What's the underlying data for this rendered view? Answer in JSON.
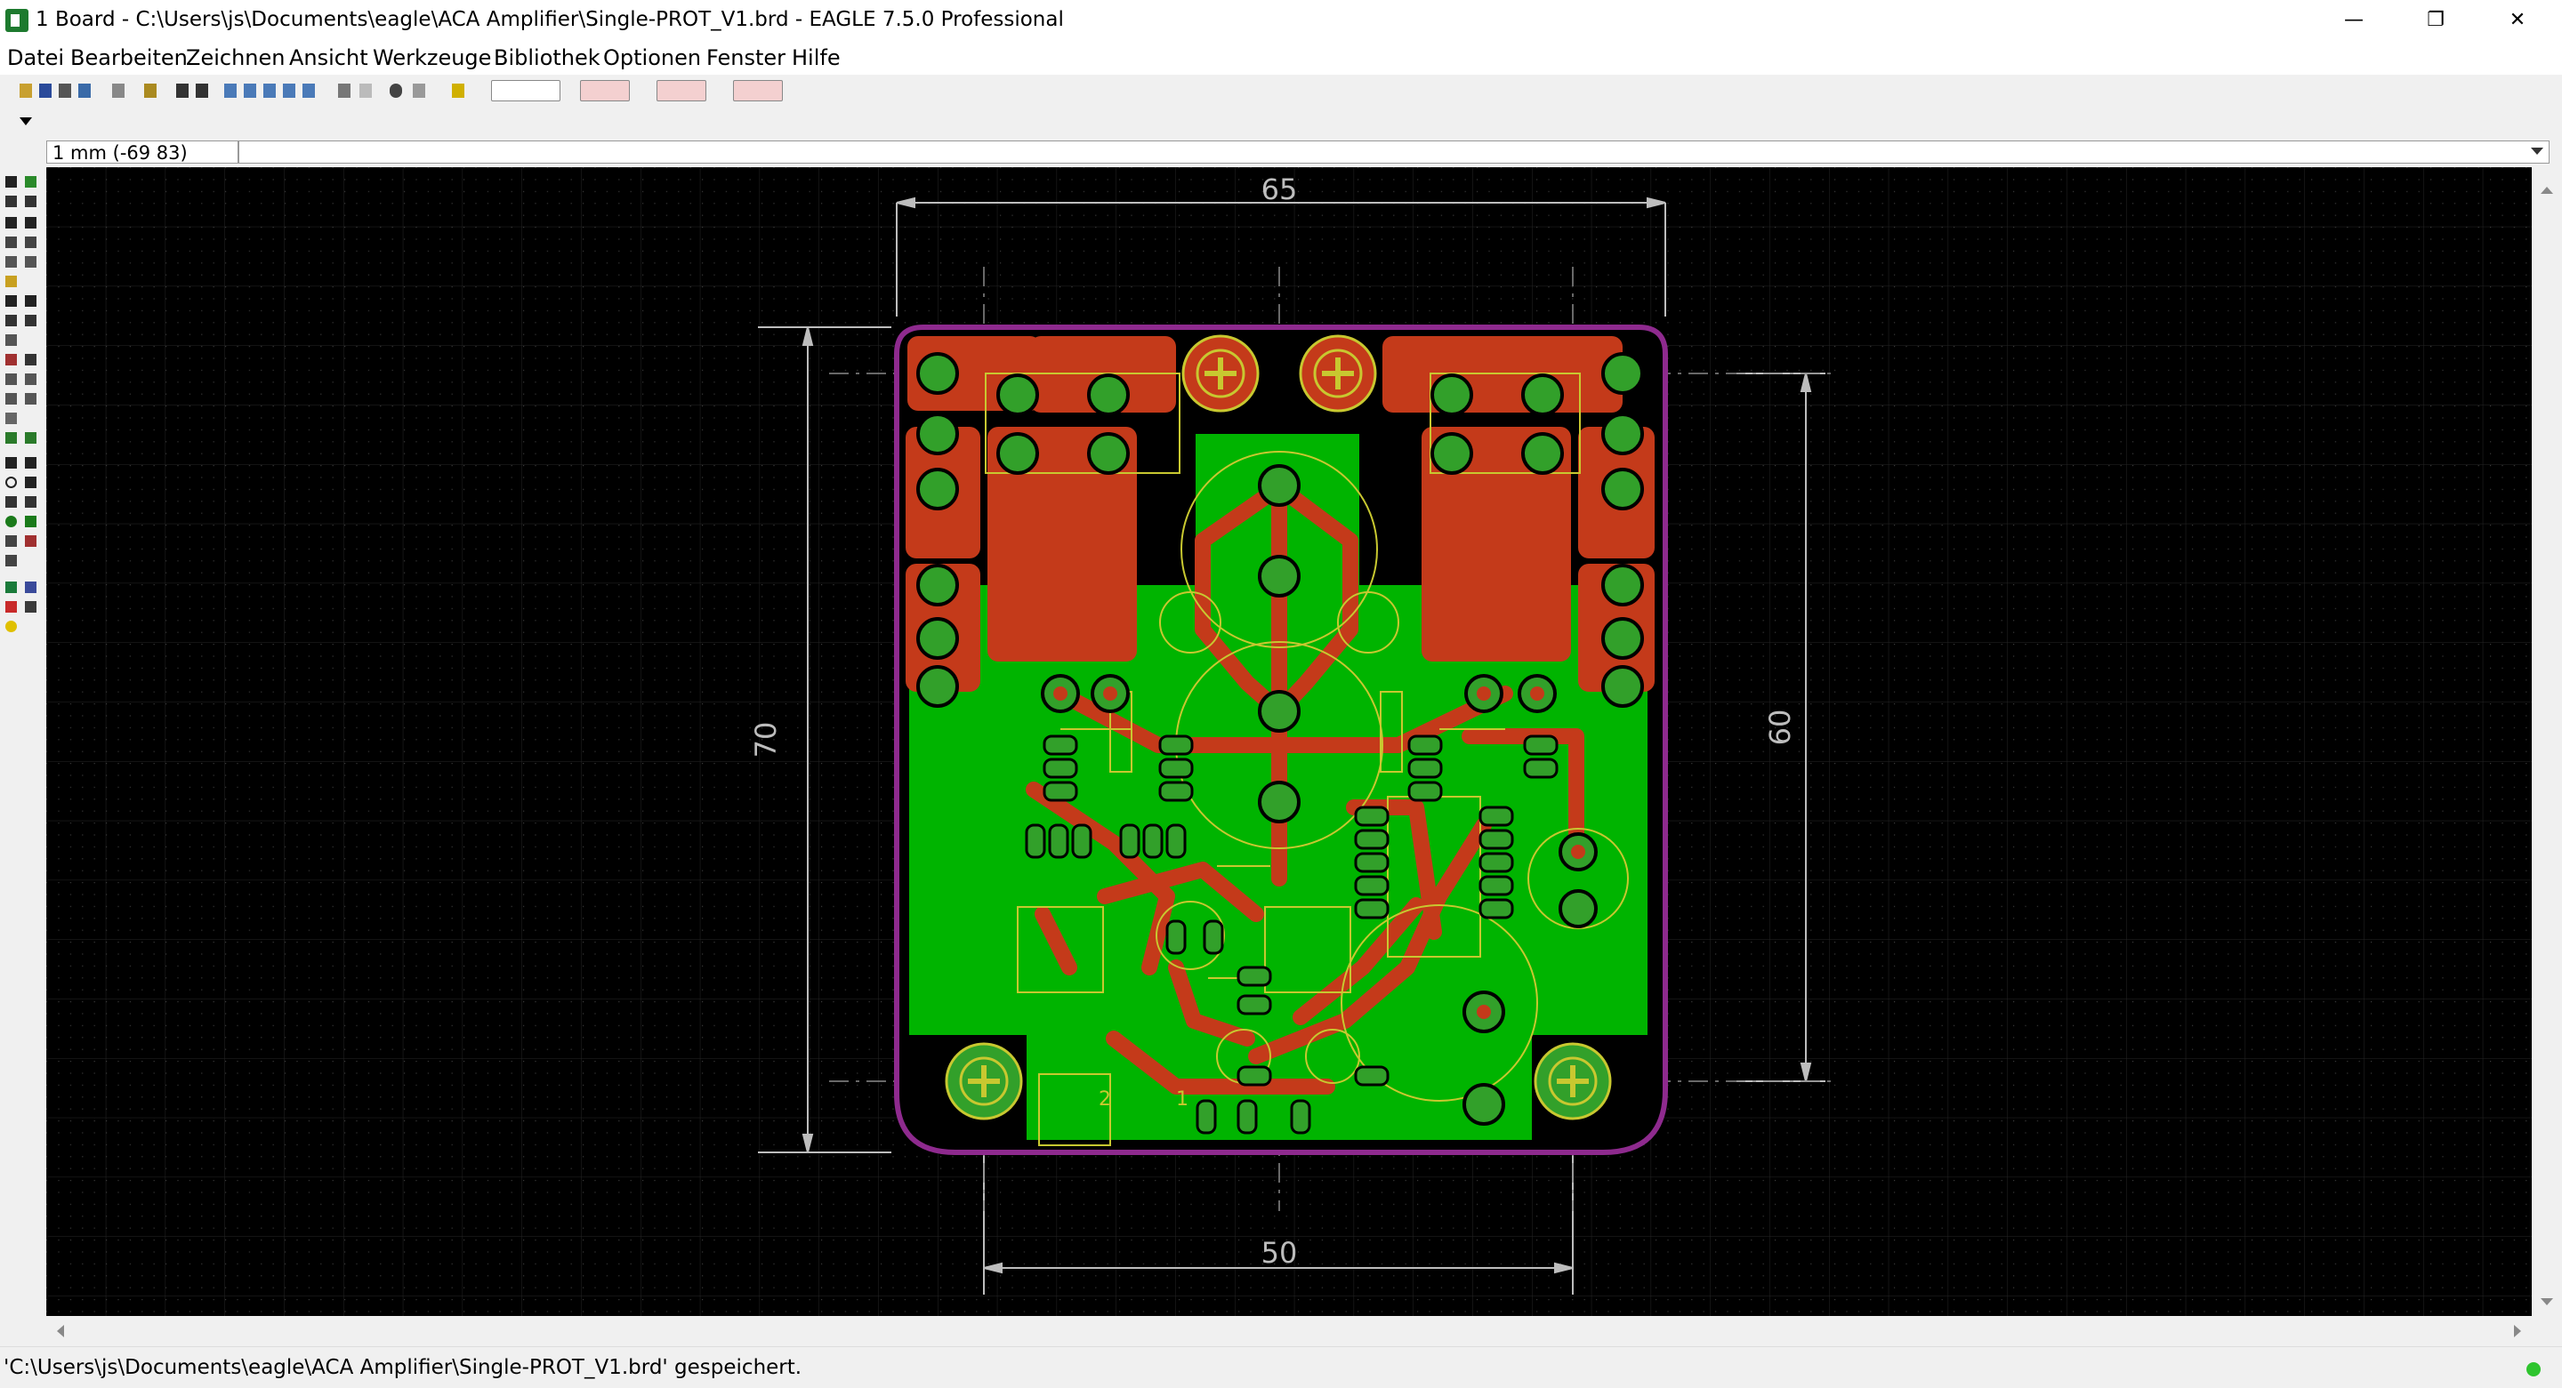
{
  "window": {
    "title": "1 Board - C:\\Users\\js\\Documents\\eagle\\ACA Amplifier\\Single-PROT_V1.brd - EAGLE 7.5.0 Professional",
    "minimize": "—",
    "restore": "❐",
    "close": "✕"
  },
  "menu": {
    "items": [
      "Datei",
      "Bearbeiten",
      "Zeichnen",
      "Ansicht",
      "Werkzeuge",
      "Bibliothek",
      "Optionen",
      "Fenster",
      "Hilfe"
    ]
  },
  "toolbar": {
    "buttons": [
      "open-icon",
      "save-icon",
      "print-icon",
      "cam-icon",
      "sch-icon",
      "script-icon",
      "run-icon",
      "drc-icon",
      "zoom-fit-icon",
      "zoom-in-icon",
      "zoom-out-icon",
      "zoom-redraw-icon",
      "zoom-select-icon",
      "undo-icon",
      "redo-icon",
      "stop-icon",
      "go-icon",
      "help-icon"
    ],
    "wide_buttons": [
      "pcb-service-button",
      "design-link-button",
      "pcb-quote-button",
      "idf-button"
    ]
  },
  "command": {
    "coordinates": "1 mm (-69 83)"
  },
  "board": {
    "dim_top": "65",
    "dim_left": "70",
    "dim_right": "60",
    "dim_bottom": "50",
    "label_2": "2",
    "label_1": "1"
  },
  "colors": {
    "copper_top": "#c43a1a",
    "copper_bottom": "#00b400",
    "pads": "#32a02a",
    "outline": "#8e2a8e",
    "silk": "#c8c830"
  },
  "status": {
    "message": "'C:\\Users\\js\\Documents\\eagle\\ACA Amplifier\\Single-PROT_V1.brd' gespeichert."
  }
}
